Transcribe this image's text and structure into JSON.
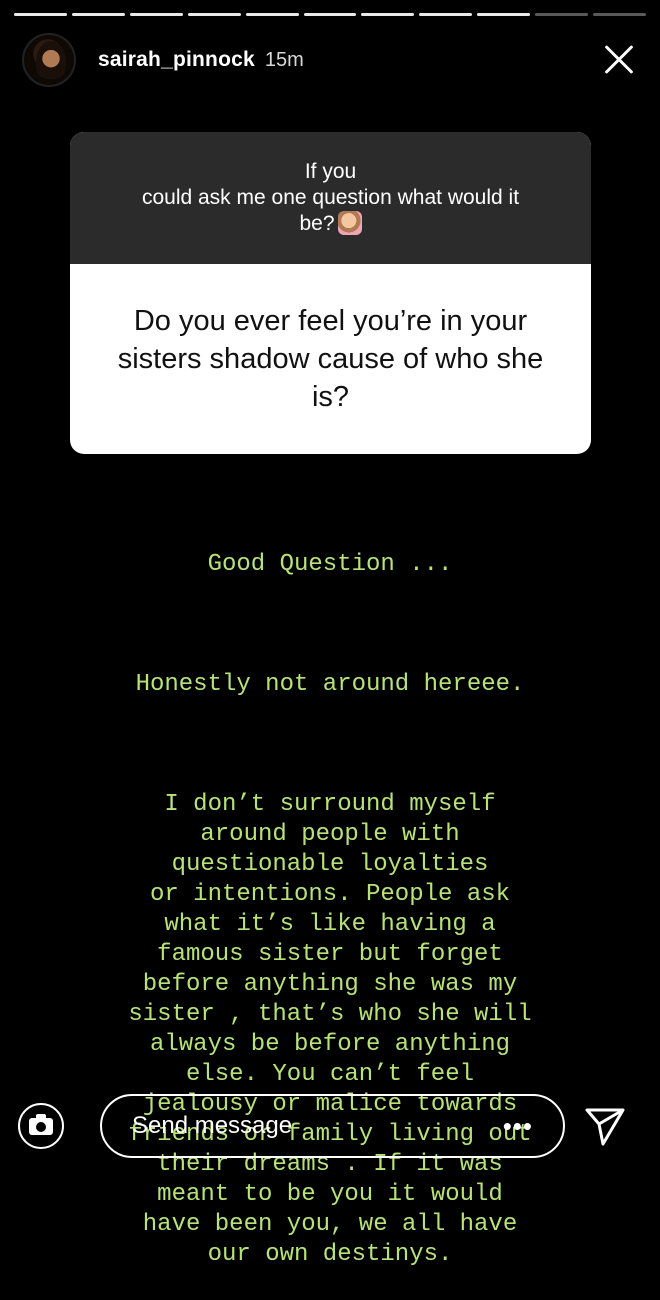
{
  "progress": {
    "total": 11,
    "current": 9
  },
  "header": {
    "username": "sairah_pinnock",
    "time": "15m"
  },
  "question_sticker": {
    "prompt_lines": [
      "If you",
      "could ask me one question what would it",
      "be?"
    ],
    "answer": "Do you ever feel you’re in your sisters shadow cause of who she is?"
  },
  "story_text": {
    "line1": "Good Question ...",
    "line2": "Honestly not around hereee.",
    "paragraph": "I don’t surround myself\naround people with\nquestionable loyalties\nor intentions. People ask\nwhat it’s like having a\nfamous sister but forget\nbefore anything she was my\nsister , that’s who she will\nalways be before anything\nelse. You can’t feel\njealousy or malice towards\nfriends or family living out\ntheir dreams . If it was\nmeant to be you it would\nhave been you, we all have\nour own destinys."
  },
  "footer": {
    "placeholder": "Send message",
    "more": "•••"
  },
  "colors": {
    "text_green": "#b7e27a",
    "sticker_header": "#2b2b2b"
  }
}
